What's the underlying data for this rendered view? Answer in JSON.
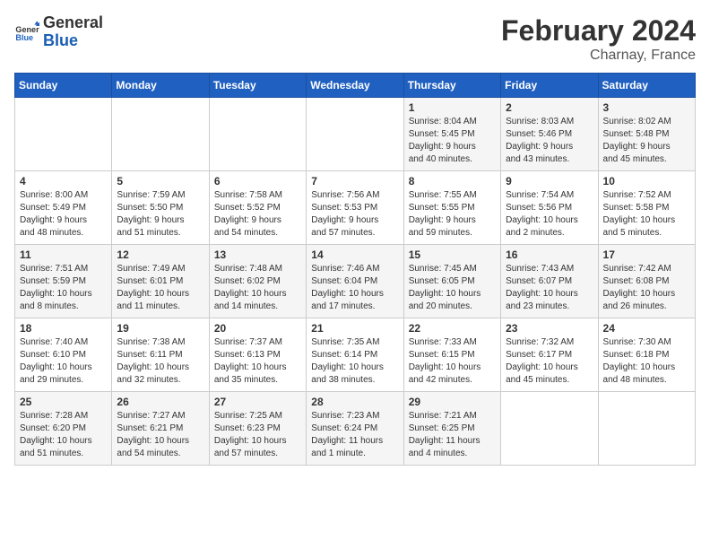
{
  "header": {
    "logo_general": "General",
    "logo_blue": "Blue",
    "month_year": "February 2024",
    "location": "Charnay, France"
  },
  "weekdays": [
    "Sunday",
    "Monday",
    "Tuesday",
    "Wednesday",
    "Thursday",
    "Friday",
    "Saturday"
  ],
  "weeks": [
    [
      {
        "day": "",
        "info": ""
      },
      {
        "day": "",
        "info": ""
      },
      {
        "day": "",
        "info": ""
      },
      {
        "day": "",
        "info": ""
      },
      {
        "day": "1",
        "info": "Sunrise: 8:04 AM\nSunset: 5:45 PM\nDaylight: 9 hours\nand 40 minutes."
      },
      {
        "day": "2",
        "info": "Sunrise: 8:03 AM\nSunset: 5:46 PM\nDaylight: 9 hours\nand 43 minutes."
      },
      {
        "day": "3",
        "info": "Sunrise: 8:02 AM\nSunset: 5:48 PM\nDaylight: 9 hours\nand 45 minutes."
      }
    ],
    [
      {
        "day": "4",
        "info": "Sunrise: 8:00 AM\nSunset: 5:49 PM\nDaylight: 9 hours\nand 48 minutes."
      },
      {
        "day": "5",
        "info": "Sunrise: 7:59 AM\nSunset: 5:50 PM\nDaylight: 9 hours\nand 51 minutes."
      },
      {
        "day": "6",
        "info": "Sunrise: 7:58 AM\nSunset: 5:52 PM\nDaylight: 9 hours\nand 54 minutes."
      },
      {
        "day": "7",
        "info": "Sunrise: 7:56 AM\nSunset: 5:53 PM\nDaylight: 9 hours\nand 57 minutes."
      },
      {
        "day": "8",
        "info": "Sunrise: 7:55 AM\nSunset: 5:55 PM\nDaylight: 9 hours\nand 59 minutes."
      },
      {
        "day": "9",
        "info": "Sunrise: 7:54 AM\nSunset: 5:56 PM\nDaylight: 10 hours\nand 2 minutes."
      },
      {
        "day": "10",
        "info": "Sunrise: 7:52 AM\nSunset: 5:58 PM\nDaylight: 10 hours\nand 5 minutes."
      }
    ],
    [
      {
        "day": "11",
        "info": "Sunrise: 7:51 AM\nSunset: 5:59 PM\nDaylight: 10 hours\nand 8 minutes."
      },
      {
        "day": "12",
        "info": "Sunrise: 7:49 AM\nSunset: 6:01 PM\nDaylight: 10 hours\nand 11 minutes."
      },
      {
        "day": "13",
        "info": "Sunrise: 7:48 AM\nSunset: 6:02 PM\nDaylight: 10 hours\nand 14 minutes."
      },
      {
        "day": "14",
        "info": "Sunrise: 7:46 AM\nSunset: 6:04 PM\nDaylight: 10 hours\nand 17 minutes."
      },
      {
        "day": "15",
        "info": "Sunrise: 7:45 AM\nSunset: 6:05 PM\nDaylight: 10 hours\nand 20 minutes."
      },
      {
        "day": "16",
        "info": "Sunrise: 7:43 AM\nSunset: 6:07 PM\nDaylight: 10 hours\nand 23 minutes."
      },
      {
        "day": "17",
        "info": "Sunrise: 7:42 AM\nSunset: 6:08 PM\nDaylight: 10 hours\nand 26 minutes."
      }
    ],
    [
      {
        "day": "18",
        "info": "Sunrise: 7:40 AM\nSunset: 6:10 PM\nDaylight: 10 hours\nand 29 minutes."
      },
      {
        "day": "19",
        "info": "Sunrise: 7:38 AM\nSunset: 6:11 PM\nDaylight: 10 hours\nand 32 minutes."
      },
      {
        "day": "20",
        "info": "Sunrise: 7:37 AM\nSunset: 6:13 PM\nDaylight: 10 hours\nand 35 minutes."
      },
      {
        "day": "21",
        "info": "Sunrise: 7:35 AM\nSunset: 6:14 PM\nDaylight: 10 hours\nand 38 minutes."
      },
      {
        "day": "22",
        "info": "Sunrise: 7:33 AM\nSunset: 6:15 PM\nDaylight: 10 hours\nand 42 minutes."
      },
      {
        "day": "23",
        "info": "Sunrise: 7:32 AM\nSunset: 6:17 PM\nDaylight: 10 hours\nand 45 minutes."
      },
      {
        "day": "24",
        "info": "Sunrise: 7:30 AM\nSunset: 6:18 PM\nDaylight: 10 hours\nand 48 minutes."
      }
    ],
    [
      {
        "day": "25",
        "info": "Sunrise: 7:28 AM\nSunset: 6:20 PM\nDaylight: 10 hours\nand 51 minutes."
      },
      {
        "day": "26",
        "info": "Sunrise: 7:27 AM\nSunset: 6:21 PM\nDaylight: 10 hours\nand 54 minutes."
      },
      {
        "day": "27",
        "info": "Sunrise: 7:25 AM\nSunset: 6:23 PM\nDaylight: 10 hours\nand 57 minutes."
      },
      {
        "day": "28",
        "info": "Sunrise: 7:23 AM\nSunset: 6:24 PM\nDaylight: 11 hours\nand 1 minute."
      },
      {
        "day": "29",
        "info": "Sunrise: 7:21 AM\nSunset: 6:25 PM\nDaylight: 11 hours\nand 4 minutes."
      },
      {
        "day": "",
        "info": ""
      },
      {
        "day": "",
        "info": ""
      }
    ]
  ]
}
